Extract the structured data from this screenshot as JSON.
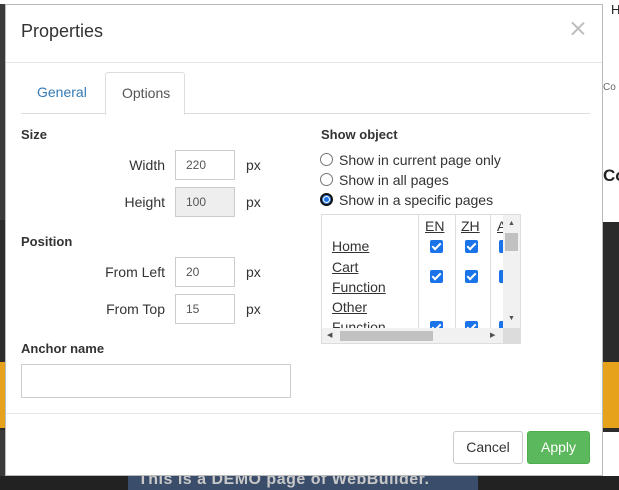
{
  "background": {
    "right_top_letter": "H",
    "right_fragment_small": "Co",
    "right_fragment_bold": "Co",
    "footer_banner_text": "This is a DEMO page of WebBuilder."
  },
  "dialog": {
    "title": "Properties",
    "close_icon": "close-icon"
  },
  "tabs": [
    {
      "label": "General",
      "active": false
    },
    {
      "label": "Options",
      "active": true
    }
  ],
  "size": {
    "heading": "Size",
    "width_label": "Width",
    "width_value": "220",
    "height_label": "Height",
    "height_value": "100",
    "unit": "px"
  },
  "position": {
    "heading": "Position",
    "left_label": "From Left",
    "left_value": "20",
    "top_label": "From Top",
    "top_value": "15",
    "unit": "px"
  },
  "anchor": {
    "heading": "Anchor name",
    "value": ""
  },
  "show_object": {
    "heading": "Show object",
    "options": [
      {
        "label": "Show in current page only",
        "selected": false
      },
      {
        "label": "Show in all pages",
        "selected": false
      },
      {
        "label": "Show in a specific pages",
        "selected": true
      }
    ]
  },
  "pages_grid": {
    "columns": [
      "EN",
      "ZH",
      "A"
    ],
    "rows": [
      {
        "name": "Home",
        "checked": [
          true,
          true,
          true
        ]
      },
      {
        "name": "Cart",
        "checked": [
          true,
          true,
          true
        ]
      },
      {
        "name": "Function",
        "checked": [
          true,
          true,
          true
        ]
      },
      {
        "name": "Other",
        "checked": [
          true,
          true,
          true
        ]
      },
      {
        "name": "Function",
        "checked": [
          true,
          true,
          true
        ]
      }
    ]
  },
  "footer": {
    "cancel_label": "Cancel",
    "apply_label": "Apply"
  },
  "colors": {
    "accent_link": "#337ab7",
    "apply_green": "#5cb85c",
    "checkbox_blue": "#1a73e8"
  }
}
